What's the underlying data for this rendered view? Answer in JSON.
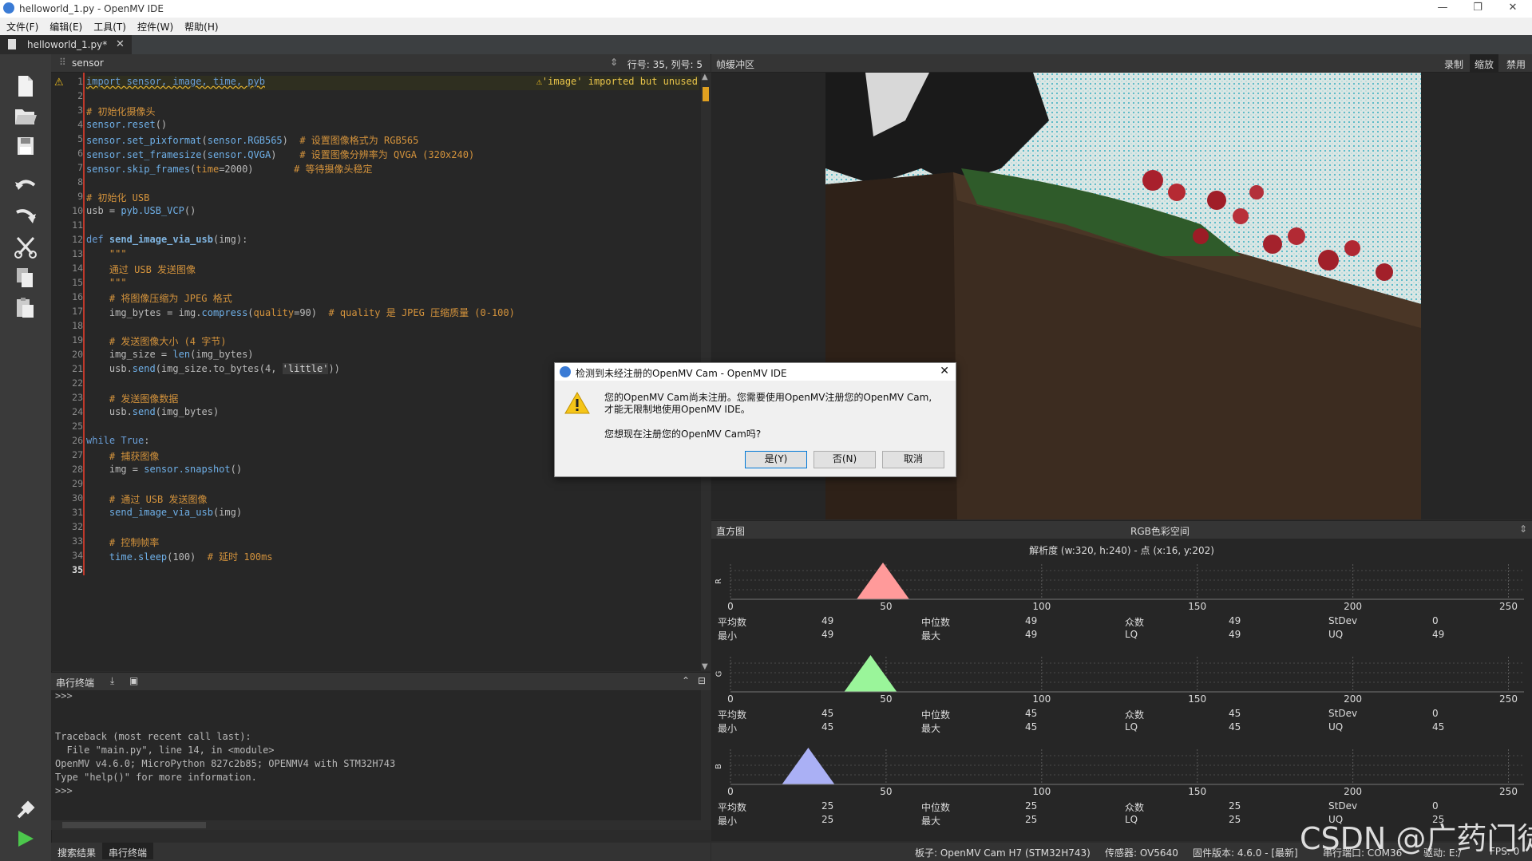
{
  "window": {
    "title": "helloworld_1.py - OpenMV IDE",
    "minimize": "—",
    "maximize": "❐",
    "close": "✕"
  },
  "menu": [
    "文件(F)",
    "编辑(E)",
    "工具(T)",
    "控件(W)",
    "帮助(H)"
  ],
  "file_tab": {
    "name": "helloworld_1.py*",
    "close": "✕"
  },
  "editor": {
    "function_selector": "sensor",
    "cursor_pos": "行号: 35, 列号: 5",
    "warning": "'image' imported but unused",
    "line_numbers": [
      "1",
      "2",
      "3",
      "4",
      "5",
      "6",
      "7",
      "8",
      "9",
      "10",
      "11",
      "12",
      "13",
      "14",
      "15",
      "16",
      "17",
      "18",
      "19",
      "20",
      "21",
      "22",
      "23",
      "24",
      "25",
      "26",
      "27",
      "28",
      "29",
      "30",
      "31",
      "32",
      "33",
      "34",
      "35"
    ]
  },
  "serial": {
    "title": "串行终端",
    "lines": [
      ">>>",
      "",
      "",
      "Traceback (most recent call last):",
      "  File \"main.py\", line 14, in <module>",
      "OpenMV v4.6.0; MicroPython 827c2b85; OPENMV4 with STM32H743",
      "Type \"help()\" for more information.",
      ">>>"
    ]
  },
  "bottom_tabs": [
    "搜索结果",
    "串行终端"
  ],
  "framebuffer": {
    "title": "帧缓冲区",
    "buttons": [
      "录制",
      "缩放",
      "禁用"
    ]
  },
  "histogram": {
    "title": "直方图",
    "colorspace": "RGB色彩空间",
    "resolution": "解析度 (w:320, h:240) - 点 (x:16, y:202)",
    "axis_ticks": [
      "0",
      "50",
      "100",
      "150",
      "200",
      "250"
    ],
    "channels": [
      {
        "label": "R",
        "color": "#ff9a9a",
        "peak": 49,
        "mean": "49",
        "median": "49",
        "mode": "49",
        "stdev": "0",
        "min": "49",
        "max": "49",
        "lq": "49",
        "uq": "49"
      },
      {
        "label": "G",
        "color": "#9af59a",
        "peak": 45,
        "mean": "45",
        "median": "45",
        "mode": "45",
        "stdev": "0",
        "min": "45",
        "max": "45",
        "lq": "45",
        "uq": "45"
      },
      {
        "label": "B",
        "color": "#aab0f5",
        "peak": 25,
        "mean": "25",
        "median": "25",
        "mode": "25",
        "stdev": "0",
        "min": "25",
        "max": "25",
        "lq": "25",
        "uq": "25"
      }
    ],
    "stat_labels": {
      "mean": "平均数",
      "median": "中位数",
      "mode": "众数",
      "stdev": "StDev",
      "min": "最小",
      "max": "最大",
      "lq": "LQ",
      "uq": "UQ"
    }
  },
  "status": {
    "board": "板子: OpenMV Cam H7 (STM32H743)",
    "sensor": "传感器: OV5640",
    "firmware": "固件版本: 4.6.0 - [最新]",
    "port": "串行端口: COM36",
    "driver": "驱动: E:/",
    "fps": "FPS: 0"
  },
  "dialog": {
    "title": "检测到未经注册的OpenMV Cam - OpenMV IDE",
    "message_line1": "您的OpenMV Cam尚未注册。您需要使用OpenMV注册您的OpenMV Cam,",
    "message_line2": "才能无限制地使用OpenMV IDE。",
    "question": "您想现在注册您的OpenMV Cam吗?",
    "yes": "是(Y)",
    "no": "否(N)",
    "cancel": "取消",
    "close": "✕"
  },
  "watermark": "CSDN @广药门徒",
  "colors": {
    "accent_warning": "#e8c44a",
    "keyword": "#6a9fd8",
    "comment": "#d4933c"
  }
}
